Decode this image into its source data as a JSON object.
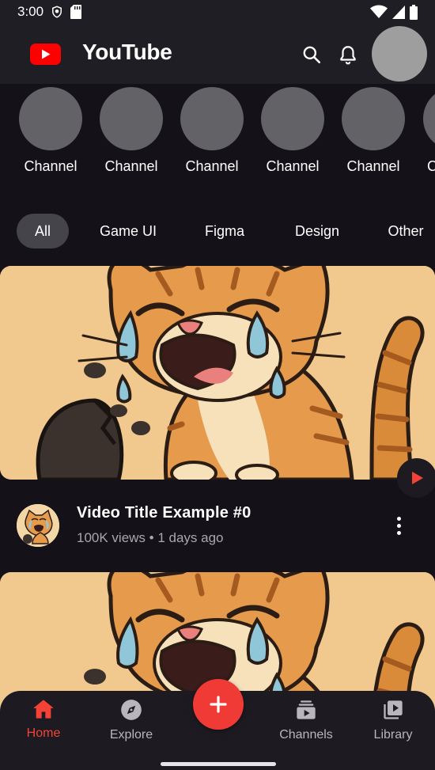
{
  "status_bar": {
    "time": "3:00"
  },
  "app_bar": {
    "title": "YouTube"
  },
  "channels": [
    {
      "label": "Channel"
    },
    {
      "label": "Channel"
    },
    {
      "label": "Channel"
    },
    {
      "label": "Channel"
    },
    {
      "label": "Channel"
    },
    {
      "label": "C"
    }
  ],
  "chips": [
    {
      "label": "All",
      "active": true
    },
    {
      "label": "Game UI"
    },
    {
      "label": "Figma"
    },
    {
      "label": "Design"
    },
    {
      "label": "Other"
    }
  ],
  "videos": [
    {
      "title": "Video Title Example #0",
      "meta": "100K views • 1 days ago"
    }
  ],
  "bottom_nav": {
    "home": "Home",
    "explore": "Explore",
    "channels": "Channels",
    "library": "Library"
  },
  "colors": {
    "accent": "#f44336",
    "background": "#141218",
    "app_bar": "#1f1e25",
    "chip_active": "#46444b"
  }
}
